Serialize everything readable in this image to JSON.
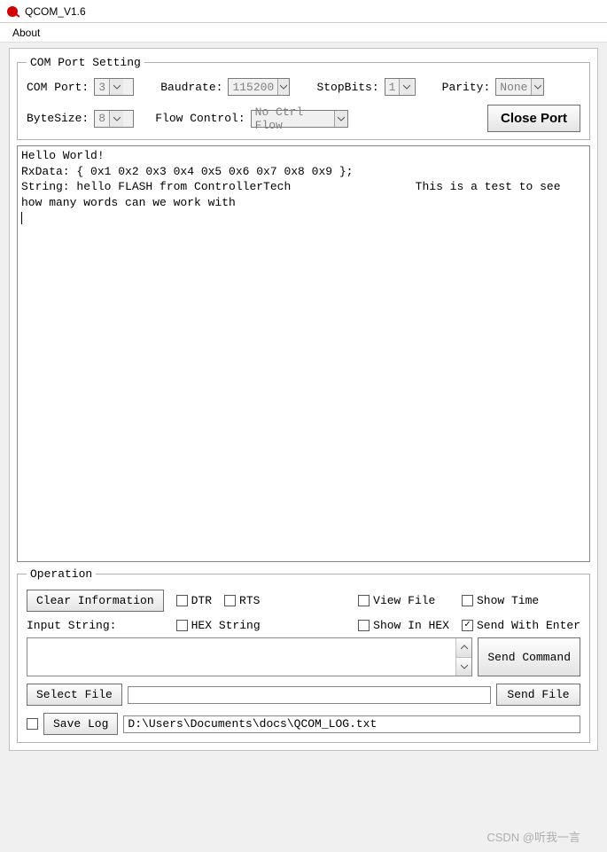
{
  "window": {
    "title": "QCOM_V1.6"
  },
  "menu": {
    "about": "About"
  },
  "comport": {
    "legend": "COM Port Setting",
    "comport_label": "COM Port:",
    "comport_value": "3",
    "baudrate_label": "Baudrate:",
    "baudrate_value": "115200",
    "stopbits_label": "StopBits:",
    "stopbits_value": "1",
    "parity_label": "Parity:",
    "parity_value": "None",
    "bytesize_label": "ByteSize:",
    "bytesize_value": "8",
    "flow_label": "Flow Control:",
    "flow_value": "No Ctrl Flow",
    "close_button": "Close Port"
  },
  "terminal": {
    "text": "Hello World!\nRxData: { 0x1 0x2 0x3 0x4 0x5 0x6 0x7 0x8 0x9 };\nString: hello FLASH from ControllerTech                  This is a test to see how many words can we work with\n"
  },
  "operation": {
    "legend": "Operation",
    "clear_button": "Clear Information",
    "dtr": "DTR",
    "rts": "RTS",
    "view_file": "View File",
    "show_time": "Show Time",
    "hex_string": "HEX String",
    "show_in_hex": "Show In HEX",
    "send_with_enter": "Send With Enter",
    "send_with_enter_checked": true,
    "input_string_label": "Input String:",
    "send_command": "Send Command",
    "select_file": "Select File",
    "send_file": "Send File",
    "save_log": "Save Log",
    "log_path": "D:\\Users\\Documents\\docs\\QCOM_LOG.txt"
  },
  "watermark": "CSDN @听我一言"
}
